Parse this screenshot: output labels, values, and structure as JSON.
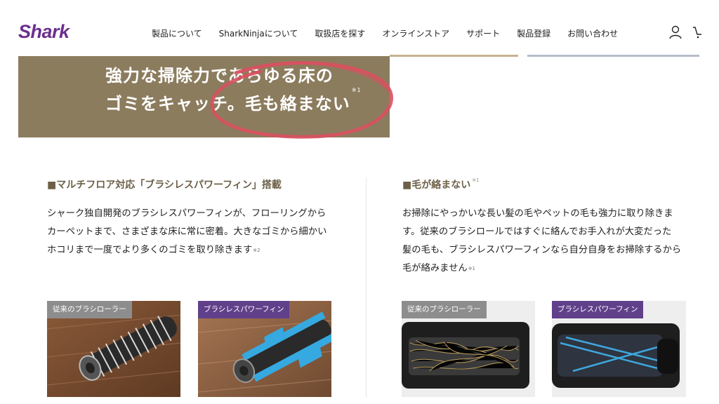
{
  "header": {
    "logo": "Shark",
    "nav": [
      "製品について",
      "SharkNinjaについて",
      "取扱店を探す",
      "オンラインストア",
      "サポート",
      "製品登録",
      "お問い合わせ"
    ]
  },
  "hero": {
    "line1": "強力な掃除力であらゆる床の",
    "line2": "ゴミをキャッチ。毛も絡まない",
    "note": "※1",
    "highlight_color": "#d9505f"
  },
  "left_section": {
    "heading": "■マルチフロア対応「ブラシレスパワーフィン」搭載",
    "body_lines": [
      "シャーク独自開発のブラシレスパワーフィンが、フローリングから",
      "カーペットまで、さまざまな床に常に密着。大きなゴミから細かい",
      "ホコリまで一度でより多くのゴミを取り除きます"
    ],
    "body_note": "※2",
    "photo1_label": "従来のブラシローラー",
    "photo2_label": "ブラシレスパワーフィン"
  },
  "right_section": {
    "heading": "■毛が絡まない",
    "heading_note": "※1",
    "body_lines": [
      "お掃除にやっかいな長い髪の毛やペットの毛も強力に取り除きま",
      "す。従来のブラシロールではすぐに絡んでお手入れが大変だった",
      "髪の毛も、ブラシレスパワーフィンなら自分自身をお掃除するから",
      "毛が絡みません"
    ],
    "body_note": "※1",
    "photo1_label": "従来のブラシローラー",
    "photo2_label": "ブラシレスパワーフィン"
  },
  "colors": {
    "brand_purple": "#6b2f8e",
    "hero_bg": "#8c7c5e",
    "heading_brown": "#6e6048",
    "label_gray": "#8d8d8d",
    "label_purple": "#60408a"
  }
}
